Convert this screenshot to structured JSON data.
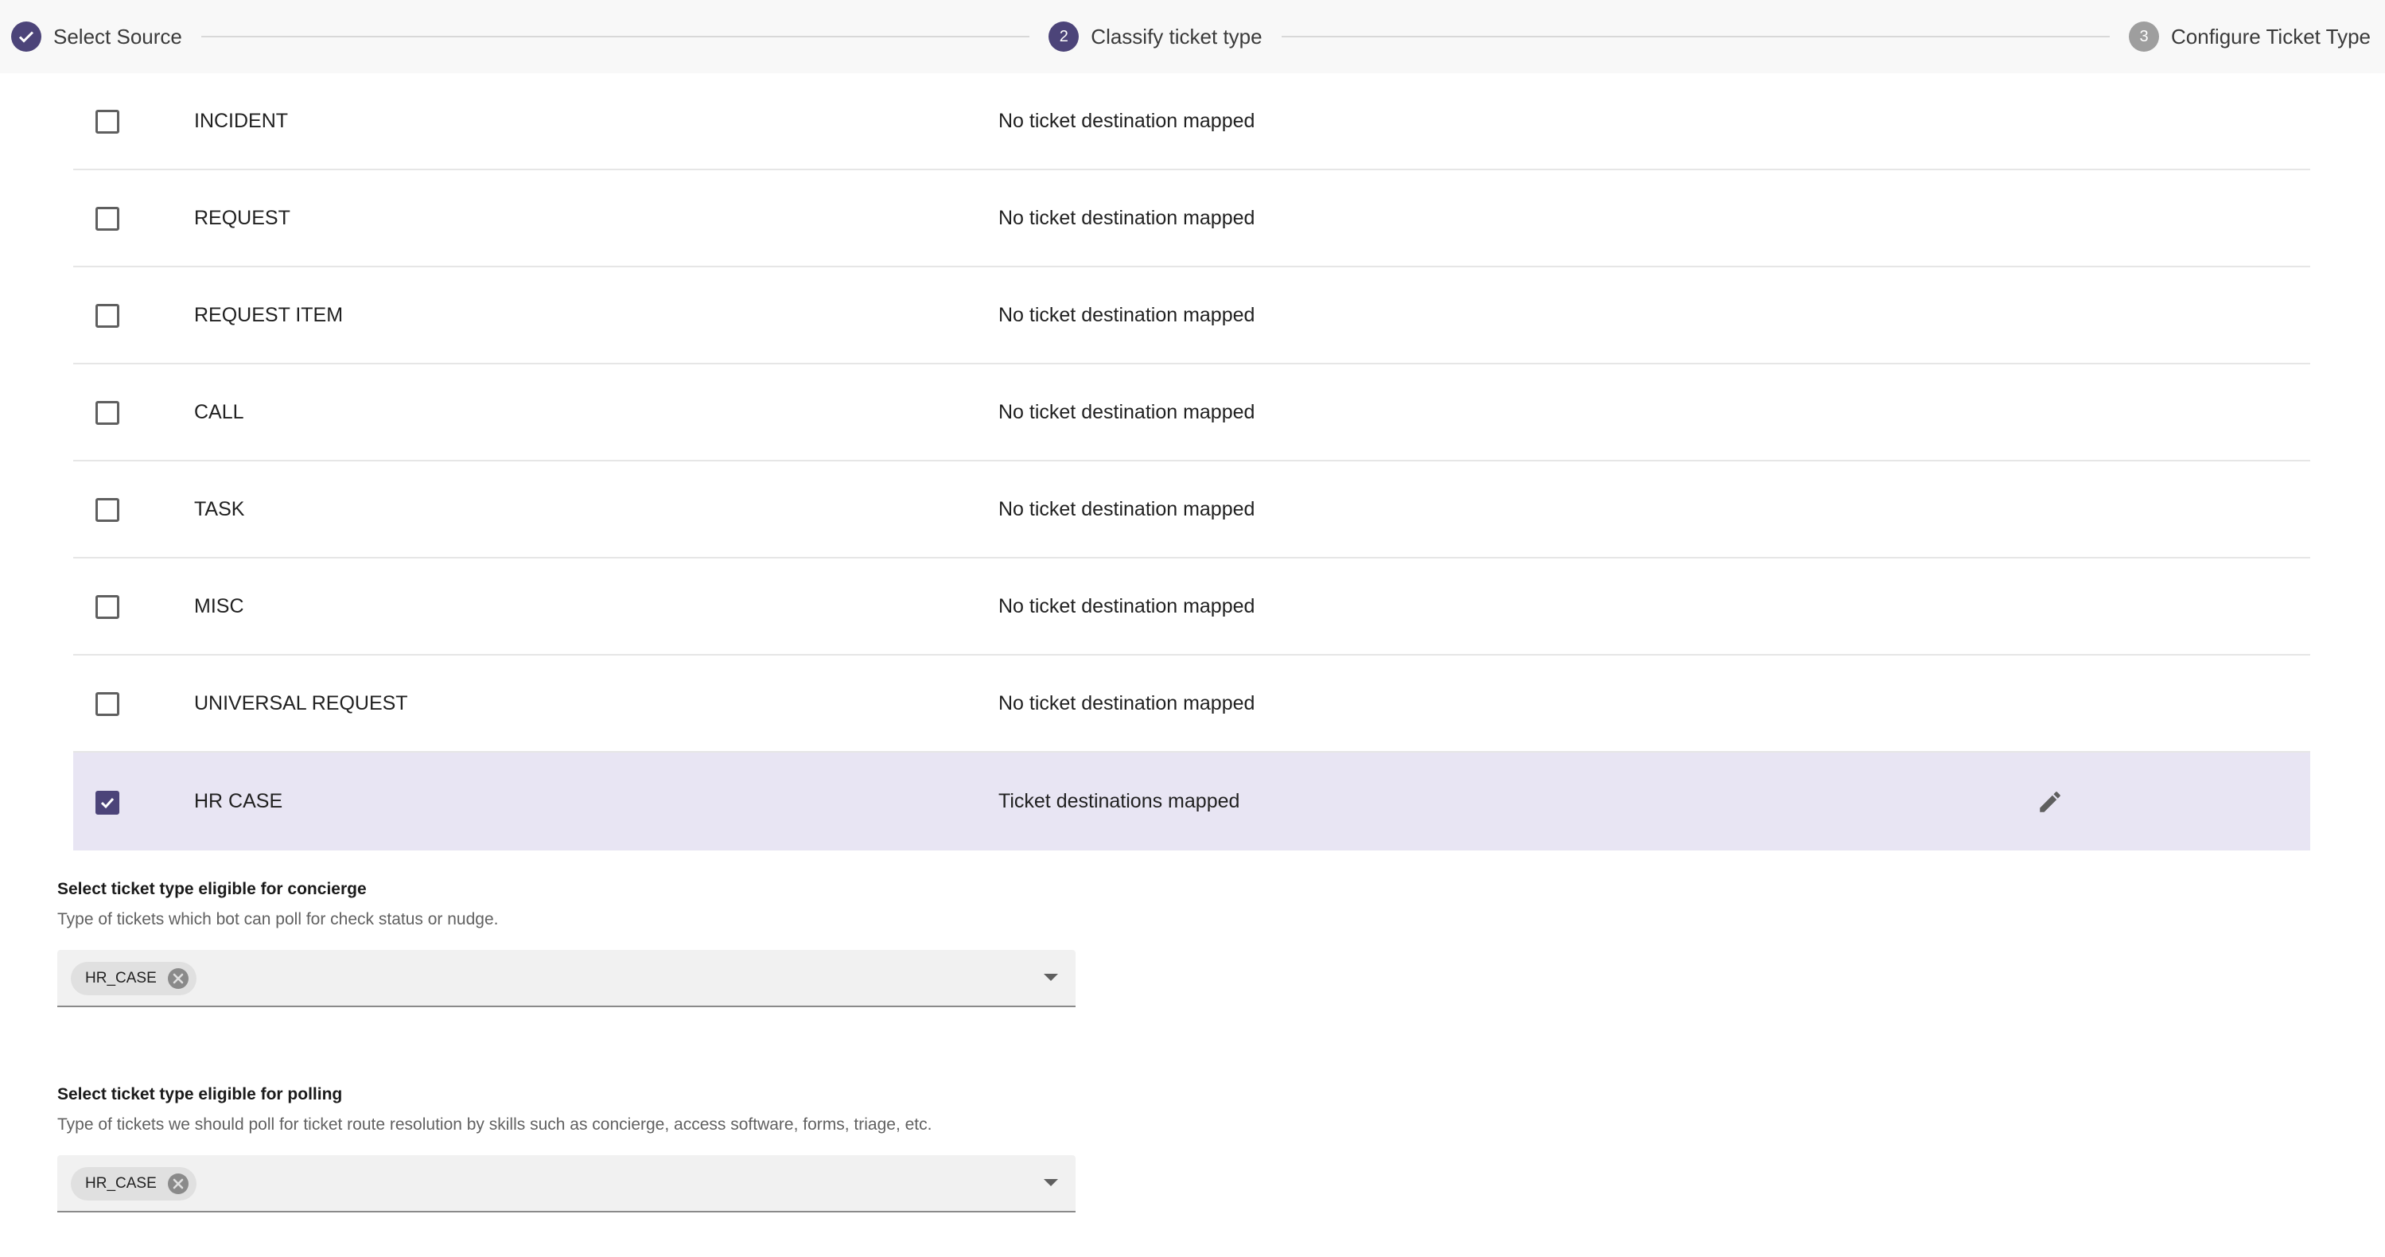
{
  "stepper": {
    "steps": [
      {
        "number": "",
        "label": "Select Source",
        "state": "completed"
      },
      {
        "number": "2",
        "label": "Classify ticket type",
        "state": "active"
      },
      {
        "number": "3",
        "label": "Configure Ticket Type",
        "state": "inactive"
      }
    ]
  },
  "ticket_types": [
    {
      "name": "INCIDENT",
      "status": "No ticket destination mapped",
      "checked": false
    },
    {
      "name": "REQUEST",
      "status": "No ticket destination mapped",
      "checked": false
    },
    {
      "name": "REQUEST ITEM",
      "status": "No ticket destination mapped",
      "checked": false
    },
    {
      "name": "CALL",
      "status": "No ticket destination mapped",
      "checked": false
    },
    {
      "name": "TASK",
      "status": "No ticket destination mapped",
      "checked": false
    },
    {
      "name": "MISC",
      "status": "No ticket destination mapped",
      "checked": false
    },
    {
      "name": "UNIVERSAL REQUEST",
      "status": "No ticket destination mapped",
      "checked": false
    },
    {
      "name": "HR CASE",
      "status": "Ticket destinations mapped",
      "checked": true
    }
  ],
  "concierge": {
    "title": "Select ticket type eligible for concierge",
    "description": "Type of tickets which bot can poll for check status or nudge.",
    "selected_chip": "HR_CASE"
  },
  "polling": {
    "title": "Select ticket type eligible for polling",
    "description": "Type of tickets we should poll for ticket route resolution by skills such as concierge, access software, forms, triage, etc.",
    "selected_chip": "HR_CASE"
  },
  "colors": {
    "accent": "#4c4479",
    "selected_row": "#e8e5f3",
    "inactive_step": "#9e9e9e"
  }
}
